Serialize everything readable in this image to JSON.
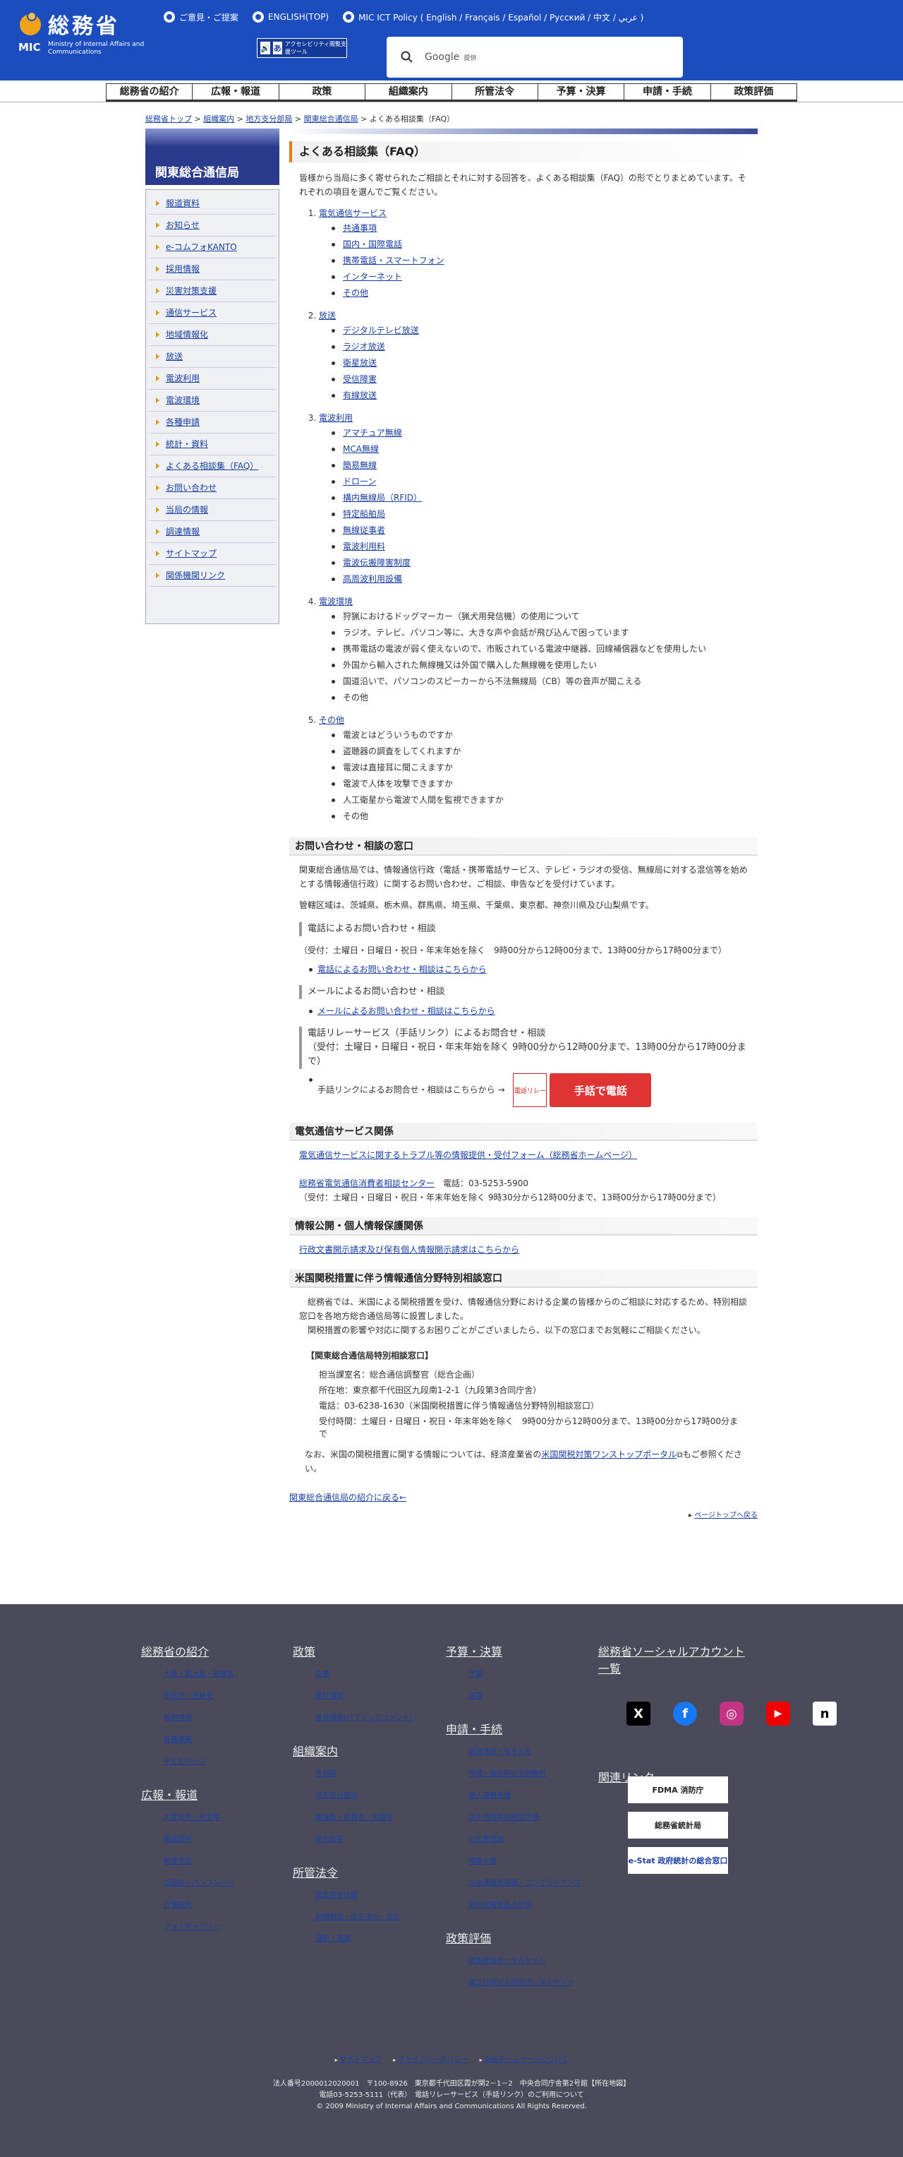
{
  "header": {
    "logo_jp": "総務省",
    "logo_mic": "MIC",
    "logo_en": "Ministry of Internal Affairs and Communications",
    "toplinks": [
      "ご意見・ご提案",
      "ENGLISH(TOP)",
      "MIC ICT Policy ( English / Français / Español / Русский / 中文 / عربي )"
    ],
    "accessibility": "アクセシビリティ閲覧支援ツール",
    "search_brand": "Google",
    "search_sub": "提供"
  },
  "gnav": [
    "総務省の紹介",
    "広報・報道",
    "政策",
    "組織案内",
    "所管法令",
    "予算・決算",
    "申請・手続",
    "政策評価"
  ],
  "breadcrumb": [
    "総務省トップ",
    "組織案内",
    "地方支分部局",
    "関東総合通信局",
    "よくある相談集（FAQ）"
  ],
  "sidebar": {
    "title": "関東総合通信局",
    "items": [
      "報道資料",
      "お知らせ",
      "e-コムフォKANTO",
      "採用情報",
      "災害対策支援",
      "通信サービス",
      "地域情報化",
      "放送",
      "電波利用",
      "電波環境",
      "各種申請",
      "統計・資料",
      "よくある相談集（FAQ）",
      "お問い合わせ",
      "当局の情報",
      "調達情報",
      "サイトマップ",
      "関係機関リンク"
    ]
  },
  "main": {
    "title": "よくある相談集（FAQ）",
    "intro": "皆様から当局に多く寄せられたご相談とそれに対する回答を、よくある相談集（FAQ）の形でとりまとめています。それぞれの項目を選んでご覧ください。",
    "faq": [
      {
        "h": "電気通信サービス",
        "items": [
          "共通事項",
          "国内・国際電話",
          "携帯電話・スマートフォン",
          "インターネット",
          "その他"
        ],
        "link": true
      },
      {
        "h": "放送",
        "items": [
          "デジタルテレビ放送",
          "ラジオ放送",
          "衛星放送",
          "受信障害",
          "有線放送"
        ],
        "link": true
      },
      {
        "h": "電波利用",
        "items": [
          "アマチュア無線",
          "MCA無線",
          "簡易無線",
          "ドローン",
          "構内無線局（RFID）",
          "特定船舶局",
          "無線従事者",
          "電波利用料",
          "電波伝搬障害制度",
          "高周波利用設備"
        ],
        "link": true
      },
      {
        "h": "電波環境",
        "items": [
          "狩猟におけるドッグマーカー（猟犬用発信機）の使用について",
          "ラジオ、テレビ、パソコン等に、大きな声や会話が飛び込んで困っています",
          "携帯電話の電波が弱く使えないので、市販されている電波中継器、回線補償器などを使用したい",
          "外国から輸入された無線機又は外国で購入した無線機を使用したい",
          "国道沿いで、パソコンのスピーカーから不法無線局（CB）等の音声が聞こえる",
          "その他"
        ],
        "link": false
      },
      {
        "h": "その他",
        "items": [
          "電波とはどういうものですか",
          "盗聴器の調査をしてくれますか",
          "電波は直接耳に聞こえますか",
          "電波で人体を攻撃できますか",
          "人工衛星から電波で人間を監視できますか",
          "その他"
        ],
        "link": false
      }
    ],
    "contact": {
      "title": "お問い合わせ・相談の窓口",
      "p1": "関東総合通信局では、情報通信行政（電話・携帯電話サービス、テレビ・ラジオの受信、無線局に対する混信等を始めとする情報通信行政）に関するお問い合わせ、ご相談、申告などを受付けています。",
      "p2": "管轄区域は、茨城県、栃木県、群馬県、埼玉県、千葉県、東京都、神奈川県及び山梨県です。",
      "tel_h": "電話によるお問い合わせ・相談",
      "tel_hours": "（受付：土曜日・日曜日・祝日・年末年始を除く　9時00分から12時00分まで、13時00分から17時00分まで）",
      "tel_link": "電話によるお問い合わせ・相談はこちらから",
      "mail_h": "メールによるお問い合わせ・相談",
      "mail_link": "メールによるお問い合わせ・相談はこちらから",
      "relay_h": "電話リレーサービス（手話リンク）によるお問合せ・相談",
      "relay_hours": "（受付：土曜日・日曜日・祝日・年末年始を除く 9時00分から12時00分まで、13時00分から17時00分まで）",
      "relay_text": "手話リンクによるお問合せ・相談はこちらから →",
      "relay_btn": "手話で電話",
      "relay_icon": "電話リレー"
    },
    "telecom": {
      "title": "電気通信サービス関係",
      "link1": "電気通信サービスに関するトラブル等の情報提供・受付フォーム（総務省ホームページ）",
      "center": "総務省電気通信消費者相談センター",
      "center_tel": "電話：03-5253-5900",
      "center_hours": "（受付：土曜日・日曜日・祝日・年末年始を除く 9時30分から12時00分まで、13時00分から17時00分まで）"
    },
    "disclosure": {
      "title": "情報公開・個人情報保護関係",
      "link": "行政文書開示請求及び保有個人情報開示請求はこちらから"
    },
    "us": {
      "title": "米国関税措置に伴う情報通信分野特別相談窓口",
      "p1": "総務省では、米国による関税措置を受け、情報通信分野における企業の皆様からのご相談に対応するため、特別相談窓口を各地方総合通信局等に設置しました。",
      "p2": "関税措置の影響や対応に関するお困りごとがございましたら、以下の窓口までお気軽にご相談ください。",
      "box_h": "【関東総合通信局特別相談窓口】",
      "dept": "担当課室名：総合通信調整官（総合企画）",
      "addr": "所在地：東京都千代田区九段南1-2-1（九段第3合同庁舎）",
      "tel": "電話：03-6238-1630（米国関税措置に伴う情報通信分野特別相談窓口）",
      "hours": "受付時間：土曜日・日曜日・祝日・年末年始を除く　9時00分から12時00分まで、13時00分から17時00分まで",
      "note_pre": "なお、米国の関税措置に関する情報については、経済産業省の",
      "note_link": "米国関税対策ワンストップポータル",
      "note_post": "もご参照ください。"
    },
    "back": "関東総合通信局の紹介に戻る←",
    "pagetop": "ページトップへ戻る"
  },
  "footer": {
    "c1": [
      {
        "h": "総務省の紹介",
        "items": [
          "大臣・副大臣・政務官",
          "所在地・連絡先",
          "採用情報",
          "各種募集",
          "子どもページ"
        ]
      },
      {
        "h": "広報・報道",
        "items": [
          "大臣会見・発言等",
          "報道資料",
          "報道予定",
          "広報誌・パンフレット",
          "行事案内",
          "フォトギャラリー"
        ]
      }
    ],
    "c2": [
      {
        "h": "政策",
        "items": [
          "白書",
          "統計情報",
          "意見募集(パブリックコメント)"
        ]
      },
      {
        "h": "組織案内",
        "items": [
          "外局等",
          "地方支分部局",
          "審議会・委員会・会議等",
          "研究会等"
        ]
      },
      {
        "h": "所管法令",
        "items": [
          "国会提出法案",
          "新規制定・改正法令・告示",
          "通知・通達"
        ]
      }
    ],
    "c3": [
      {
        "h": "予算・決算",
        "items": [
          "予算",
          "決算"
        ]
      },
      {
        "h": "申請・手続",
        "items": [
          "調達情報・電子入札",
          "申請・届出等の手続案内",
          "個人情報保護",
          "法令適用事前確認手続",
          "公文書管理",
          "情報公開",
          "公益通報者保護・コンプライアンス",
          "受託収賄食品の提供"
        ]
      },
      {
        "h": "政策評価",
        "items": [
          "政策評価ポータルサイト",
          "独立行政法人評価ポータルサイト"
        ]
      }
    ],
    "social_h": "総務省ソーシャルアカウント一覧",
    "social": [
      "X",
      "f",
      "◎",
      "▶",
      "n"
    ],
    "related_h": "関連リンク",
    "banners": [
      "FDMA 消防庁",
      "総務省統計局",
      "e-Stat 政府統計の総合窓口"
    ],
    "links": [
      "サイトマップ",
      "プライバシーポリシー",
      "当省ホームページについて"
    ],
    "addr": "法人番号2000012020001　〒100-8926　東京都千代田区霞が関2－1－2　中央合同庁舎第2号館【所在地図】",
    "tel": "電話03-5253-5111（代表）　電話リレーサービス（手話リンク）のご利用について",
    "copy": "© 2009 Ministry of Internal Affairs and Communications All Rights Reserved."
  }
}
